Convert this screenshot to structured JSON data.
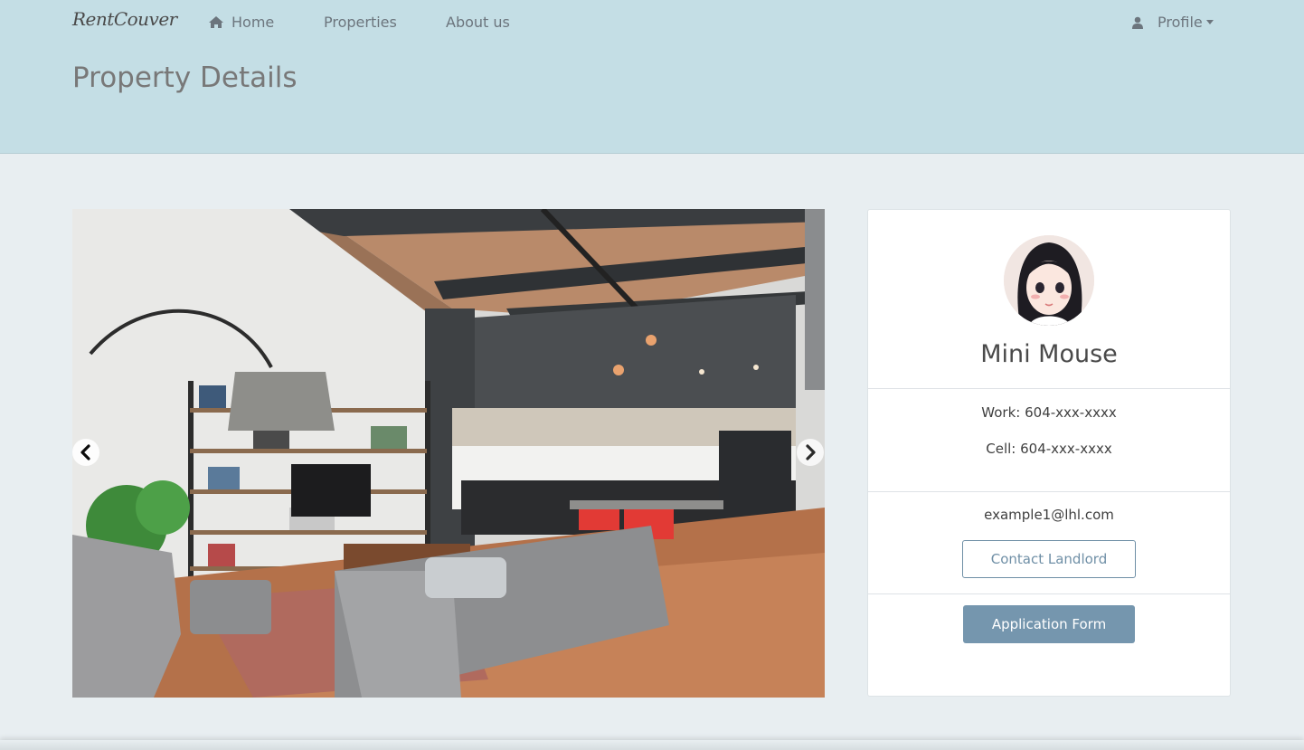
{
  "nav": {
    "brand": "RentCouver",
    "home_label": "Home",
    "properties_label": "Properties",
    "about_label": "About us",
    "profile_label": "Profile"
  },
  "header": {
    "title": "Property Details"
  },
  "landlord": {
    "name": "Mini Mouse",
    "work_phone": "Work: 604-xxx-xxxx",
    "cell_phone": "Cell: 604-xxx-xxxx",
    "email": "example1@lhl.com",
    "contact_label": "Contact Landlord",
    "application_label": "Application Form"
  },
  "icons": {
    "home": "home-icon",
    "user": "user-icon",
    "prev": "chevron-left-icon",
    "next": "chevron-right-icon"
  },
  "colors": {
    "header_bg": "#c4dee5",
    "page_bg": "#e8eef1",
    "accent": "#7596ae"
  }
}
